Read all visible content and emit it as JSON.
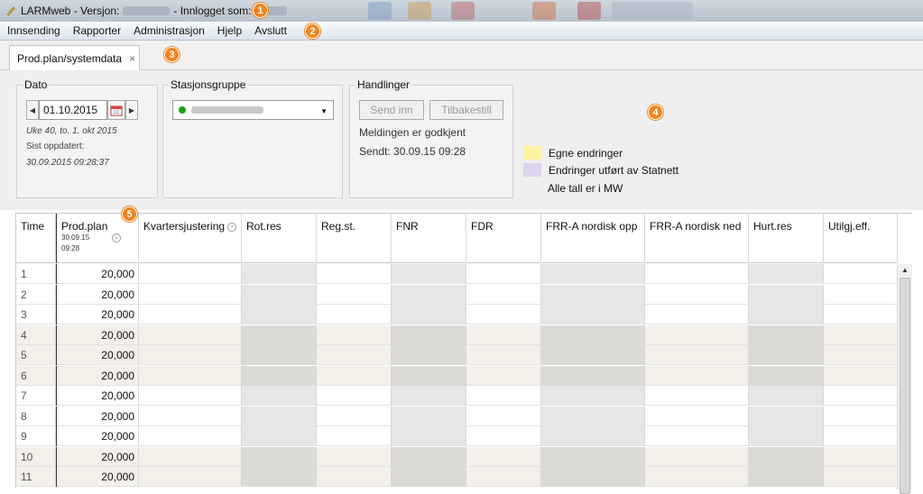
{
  "window": {
    "title_app": "LARMweb - Versjon:",
    "title_user_label": "- Innlogget som:"
  },
  "callouts": [
    "1",
    "2",
    "3",
    "4",
    "5"
  ],
  "menu": [
    "Innsending",
    "Rapporter",
    "Administrasjon",
    "Hjelp",
    "Avslutt"
  ],
  "tab": {
    "label": "Prod.plan/systemdata",
    "close": "×"
  },
  "dato": {
    "label": "Dato",
    "value": "01.10.2015",
    "week": "Uke 40, to. 1. okt 2015",
    "updated_label": "Sist oppdatert:",
    "updated_value": "30.09.2015 09:28:37"
  },
  "stasjon": {
    "label": "Stasjonsgruppe"
  },
  "handlinger": {
    "label": "Handlinger",
    "send": "Send inn",
    "reset": "Tilbakestill",
    "status": "Meldingen er godkjent",
    "sent": "Sendt: 30.09.15 09:28"
  },
  "legend": {
    "own": "Egne endringer",
    "statnett": "Endringer utført av Statnett",
    "unit": "Alle tall er i MW",
    "own_color": "#fbf3a0",
    "statnett_color": "#ddd3f0"
  },
  "columns": [
    "Time",
    "Prod.plan",
    "Kvartersjustering",
    "Rot.res",
    "Reg.st.",
    "FNR",
    "FDR",
    "FRR-A nordisk opp",
    "FRR-A nordisk ned",
    "Hurt.res",
    "Utilgj.eff."
  ],
  "prodplan_sub": [
    "30.09.15",
    "09:28"
  ],
  "rows": [
    {
      "time": "1",
      "prod": "20,000"
    },
    {
      "time": "2",
      "prod": "20,000"
    },
    {
      "time": "3",
      "prod": "20,000"
    },
    {
      "time": "4",
      "prod": "20,000"
    },
    {
      "time": "5",
      "prod": "20,000"
    },
    {
      "time": "6",
      "prod": "20,000"
    },
    {
      "time": "7",
      "prod": "20,000"
    },
    {
      "time": "8",
      "prod": "20,000"
    },
    {
      "time": "9",
      "prod": "20,000"
    },
    {
      "time": "10",
      "prod": "20,000"
    },
    {
      "time": "11",
      "prod": "20,000"
    }
  ]
}
